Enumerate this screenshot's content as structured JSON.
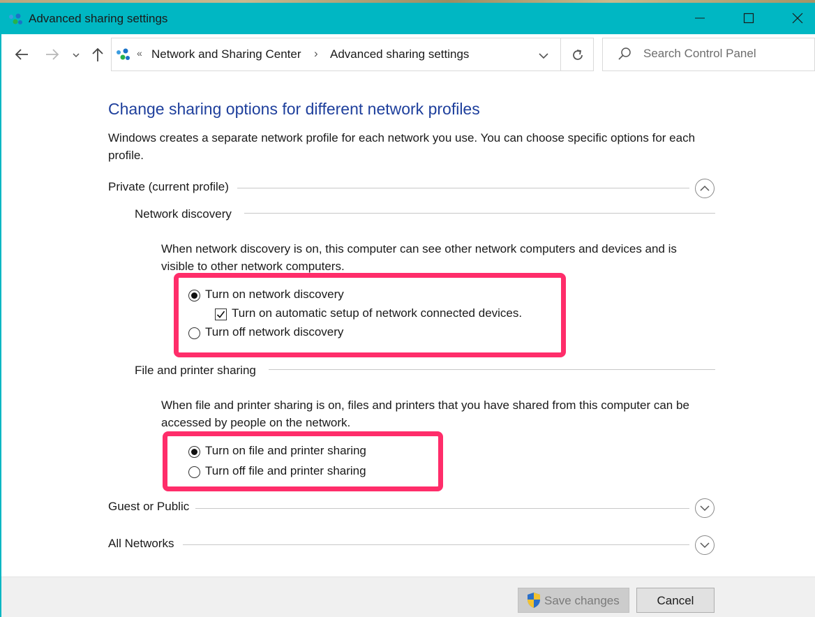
{
  "window": {
    "title": "Advanced sharing settings",
    "accent": "#00b7c3"
  },
  "nav": {
    "breadcrumb_overflow": "«",
    "crumbs": [
      "Network and Sharing Center",
      "Advanced sharing settings"
    ],
    "crumb_separator": "›",
    "search_placeholder": "Search Control Panel"
  },
  "main": {
    "heading": "Change sharing options for different network profiles",
    "intro": "Windows creates a separate network profile for each network you use. You can choose specific options for each profile.",
    "profiles": [
      {
        "label": "Private (current profile)",
        "expanded": true
      },
      {
        "label": "Guest or Public",
        "expanded": false
      },
      {
        "label": "All Networks",
        "expanded": false
      }
    ],
    "network_discovery": {
      "title": "Network discovery",
      "description": "When network discovery is on, this computer can see other network computers and devices and is visible to other network computers.",
      "option_on": "Turn on network discovery",
      "option_auto_setup": "Turn on automatic setup of network connected devices.",
      "option_off": "Turn off network discovery",
      "selected": "on",
      "auto_setup_checked": true
    },
    "file_sharing": {
      "title": "File and printer sharing",
      "description": "When file and printer sharing is on, files and printers that you have shared from this computer can be accessed by people on the network.",
      "option_on": "Turn on file and printer sharing",
      "option_off": "Turn off file and printer sharing",
      "selected": "on"
    },
    "highlight_color": "#ff2d6a"
  },
  "footer": {
    "save_label": "Save changes",
    "save_enabled": false,
    "cancel_label": "Cancel"
  }
}
